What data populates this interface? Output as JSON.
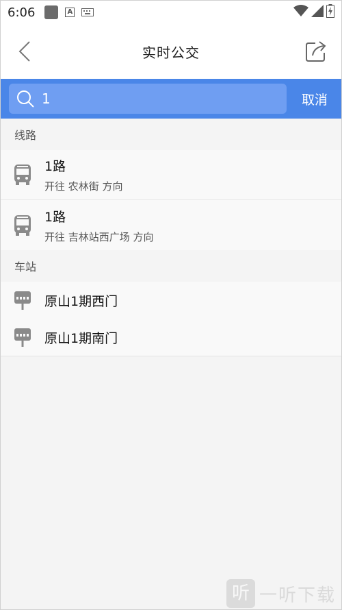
{
  "status_bar": {
    "time": "6:06",
    "icons": [
      "app-square-icon",
      "a-icon",
      "keyboard-icon",
      "wifi-icon",
      "signal-icon",
      "battery-icon"
    ]
  },
  "header": {
    "title": "实时公交",
    "back_icon": "chevron-left-icon",
    "share_icon": "share-icon"
  },
  "search": {
    "value": "1",
    "cancel_label": "取消",
    "bar_color": "#4a86e8",
    "box_color": "#6f9ef2"
  },
  "routes": {
    "header": "线路",
    "items": [
      {
        "name": "1路",
        "direction": "开往 农林街 方向"
      },
      {
        "name": "1路",
        "direction": "开往 吉林站西广场 方向"
      }
    ]
  },
  "stations": {
    "header": "车站",
    "items": [
      {
        "name": "原山1期西门"
      },
      {
        "name": "原山1期南门"
      }
    ]
  },
  "watermark": {
    "logo": "听",
    "text": "一听下载"
  }
}
